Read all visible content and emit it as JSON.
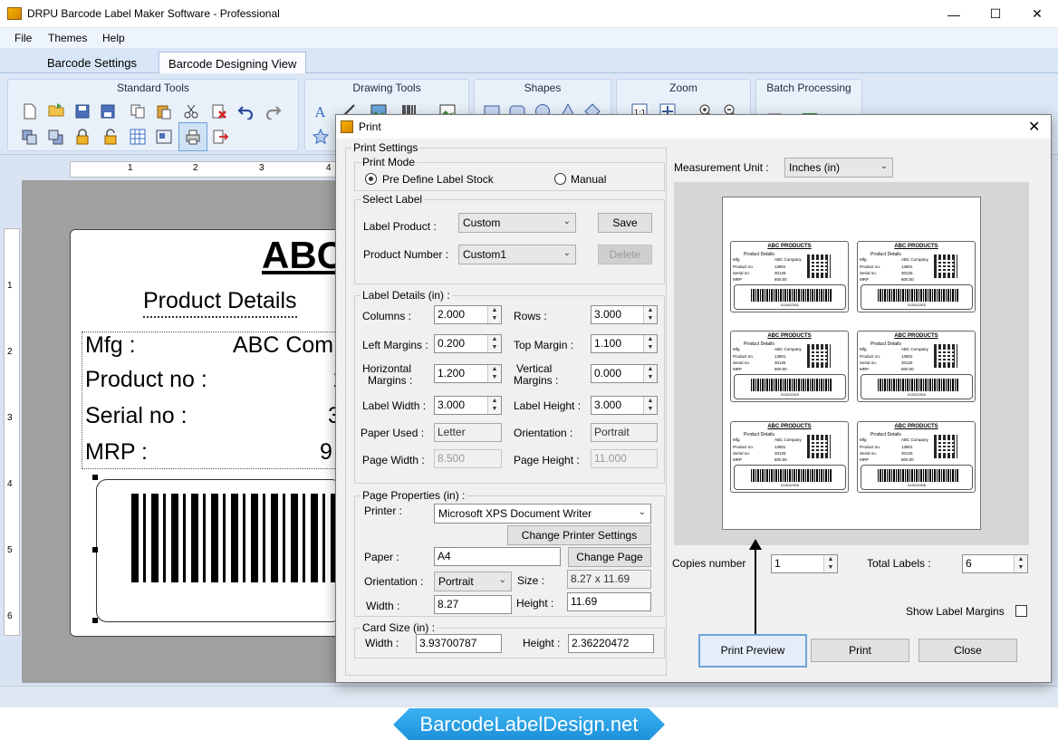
{
  "window": {
    "title": "DRPU Barcode Label Maker Software - Professional",
    "min": "—",
    "max": "☐",
    "close": "✕"
  },
  "menu": [
    "File",
    "Themes",
    "Help"
  ],
  "tabs": [
    "Barcode Settings",
    "Barcode Designing View"
  ],
  "ribbon": {
    "standard_tools": "Standard Tools",
    "drawing_tools": "Drawing Tools",
    "shapes": "Shapes",
    "zoom": "Zoom",
    "batch": "Batch Processing"
  },
  "ruler": {
    "h": [
      "1",
      "2",
      "3",
      "4"
    ],
    "v": [
      "1",
      "2",
      "3",
      "4",
      "5",
      "6"
    ]
  },
  "design_label": {
    "title": "ABC",
    "subtitle": "Product Details",
    "rows": [
      {
        "key": "Mfg :",
        "val": "ABC Com"
      },
      {
        "key": "Product no :",
        "val": "1"
      },
      {
        "key": "Serial no :",
        "val": "3"
      },
      {
        "key": "MRP :",
        "val": "9"
      }
    ]
  },
  "banner": "BarcodeLabelDesign.net",
  "dialog": {
    "title": "Print",
    "print_settings": "Print Settings",
    "print_mode": "Print Mode",
    "predefine": "Pre Define Label Stock",
    "manual": "Manual",
    "select_label": "Select Label",
    "label_product_lbl": "Label Product :",
    "label_product_val": "Custom",
    "save": "Save",
    "product_number_lbl": "Product Number :",
    "product_number_val": "Custom1",
    "delete": "Delete",
    "label_details": "Label Details (in) :",
    "columns_lbl": "Columns :",
    "columns": "2.000",
    "rows_lbl": "Rows :",
    "rows": "3.000",
    "left_margins_lbl": "Left Margins :",
    "left_margins": "0.200",
    "top_margin_lbl": "Top Margin :",
    "top_margin": "1.100",
    "hmargins_lbl1": "Horizontal",
    "hmargins_lbl2": "Margins :",
    "hmargins": "1.200",
    "vmargins_lbl1": "Vertical",
    "vmargins_lbl2": "Margins :",
    "vmargins": "0.000",
    "label_width_lbl": "Label Width :",
    "label_width": "3.000",
    "label_height_lbl": "Label Height :",
    "label_height": "3.000",
    "paper_used_lbl": "Paper Used :",
    "paper_used": "Letter",
    "orientation_lbl": "Orientation :",
    "orientation": "Portrait",
    "page_width_lbl": "Page Width :",
    "page_width": "8.500",
    "page_height_lbl": "Page Height :",
    "page_height": "11.000",
    "page_properties": "Page Properties (in) :",
    "printer_lbl": "Printer :",
    "printer": "Microsoft XPS Document Writer",
    "change_printer": "Change Printer Settings",
    "paper_lbl": "Paper :",
    "paper": "A4",
    "change_page": "Change Page",
    "orient2_lbl": "Orientation :",
    "orient2": "Portrait",
    "size_lbl": "Size :",
    "size": "8.27 x 11.69",
    "width_lbl": "Width :",
    "width": "8.27",
    "height_lbl": "Height :",
    "height": "11.69",
    "card_size": "Card Size (in) :",
    "card_width_lbl": "Width :",
    "card_width": "3.93700787",
    "card_height_lbl": "Height :",
    "card_height": "2.36220472",
    "measurement_lbl": "Measurement Unit :",
    "measurement": "Inches (in)",
    "copies_lbl": "Copies number",
    "copies": "1",
    "total_lbl": "Total Labels :",
    "total": "6",
    "show_margins": "Show Label Margins",
    "print_preview": "Print Preview",
    "print": "Print",
    "close": "Close"
  },
  "preview_labels": [
    {
      "title": "ABC PRODUCTS",
      "sub": "Product Details",
      "mfg": "ABC Company",
      "pn": "13801",
      "sn": "30125",
      "mrp": "800.00",
      "bn": "013012301"
    },
    {
      "title": "ABC PRODUCTS",
      "sub": "Product Details",
      "mfg": "ABC Company",
      "pn": "13801",
      "sn": "30125",
      "mrp": "800.00",
      "bn": "013012302"
    },
    {
      "title": "ABC PRODUCTS",
      "sub": "Product Details",
      "mfg": "ABC Company",
      "pn": "13801",
      "sn": "30125",
      "mrp": "800.00",
      "bn": "013012303"
    },
    {
      "title": "ABC PRODUCTS",
      "sub": "Product Details",
      "mfg": "ABC Company",
      "pn": "13801",
      "sn": "30125",
      "mrp": "800.00",
      "bn": "013012304"
    },
    {
      "title": "ABC PRODUCTS",
      "sub": "Product Details",
      "mfg": "ABC Company",
      "pn": "13801",
      "sn": "30125",
      "mrp": "800.00",
      "bn": "013012305"
    },
    {
      "title": "ABC PRODUCTS",
      "sub": "Product Details",
      "mfg": "ABC Company",
      "pn": "13801",
      "sn": "30125",
      "mrp": "800.00",
      "bn": "013012306"
    }
  ],
  "preview_row_labels": {
    "mfg": "Mfg",
    "pn": "Product no.",
    "sn": "Serial no.",
    "mrp": "MRP"
  }
}
